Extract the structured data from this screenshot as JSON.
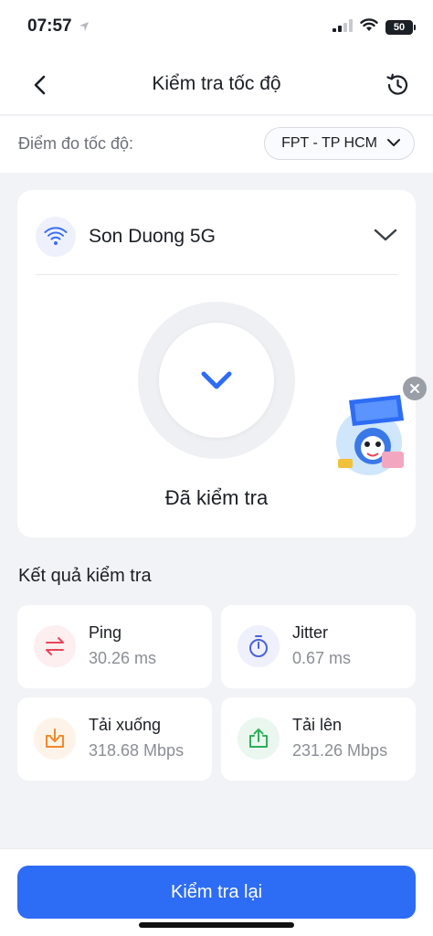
{
  "status_bar": {
    "time": "07:57",
    "battery": "50"
  },
  "nav": {
    "title": "Kiểm tra tốc độ",
    "back_icon": "chevron-left-icon",
    "history_icon": "history-icon"
  },
  "server": {
    "label": "Điểm đo tốc độ:",
    "selected": "FPT - TP HCM"
  },
  "network": {
    "name": "Son Duong 5G",
    "icon": "wifi-icon"
  },
  "test": {
    "status": "Đã kiểm tra",
    "icon": "check-icon"
  },
  "results": {
    "title": "Kết quả kiểm tra",
    "items": [
      {
        "label": "Ping",
        "value": "30.26 ms",
        "icon": "ping-arrows-icon",
        "color": "#e8455a"
      },
      {
        "label": "Jitter",
        "value": "0.67 ms",
        "icon": "stopwatch-icon",
        "color": "#4a63d8"
      },
      {
        "label": "Tải xuống",
        "value": "318.68 Mbps",
        "icon": "download-icon",
        "color": "#f08a2c"
      },
      {
        "label": "Tải lên",
        "value": "231.26 Mbps",
        "icon": "upload-icon",
        "color": "#2fae5a"
      }
    ]
  },
  "footer": {
    "retest_label": "Kiểm tra lại"
  },
  "colors": {
    "accent": "#2d6cf5",
    "background": "#f2f3f6"
  }
}
